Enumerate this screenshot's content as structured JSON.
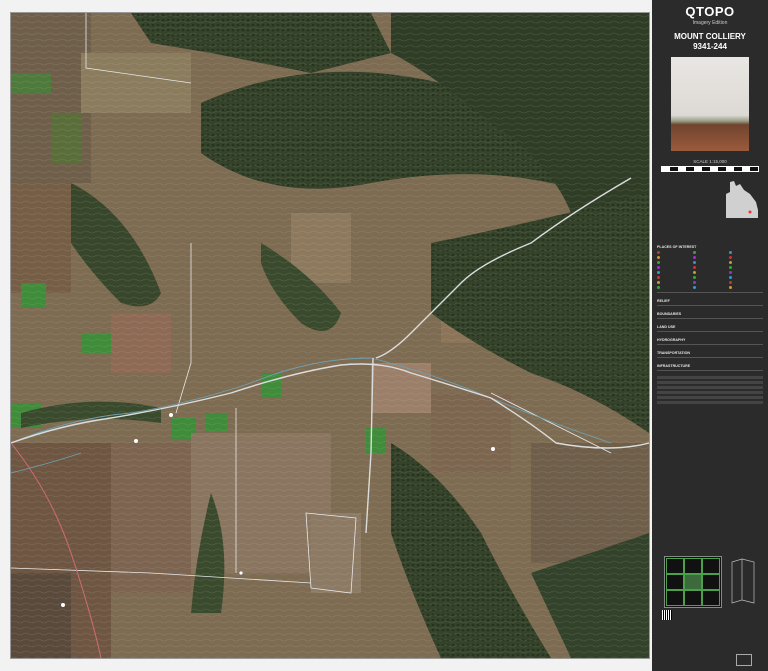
{
  "panel": {
    "title": "QTOPO",
    "subtitle": "Imagery Edition",
    "map_name": "MOUNT COLLIERY",
    "map_code": "9341-244",
    "scale_label": "SCALE 1:15,000"
  },
  "legend": {
    "sections": [
      "PLACES OF INTEREST",
      "RELIEF",
      "BOUNDARIES",
      "LAND USE",
      "HYDROGRAPHY",
      "TRANSPORTATION",
      "INFRASTRUCTURE"
    ]
  },
  "colors": {
    "vegetation": "#3b4a2b",
    "cleared_land": "#8a7358",
    "paddock_green": "#3f8c3a",
    "road": "#dcdcdc",
    "panel_bg": "#2b2b2b"
  },
  "map": {
    "alt": "Aerial imagery topographic map with contours"
  }
}
